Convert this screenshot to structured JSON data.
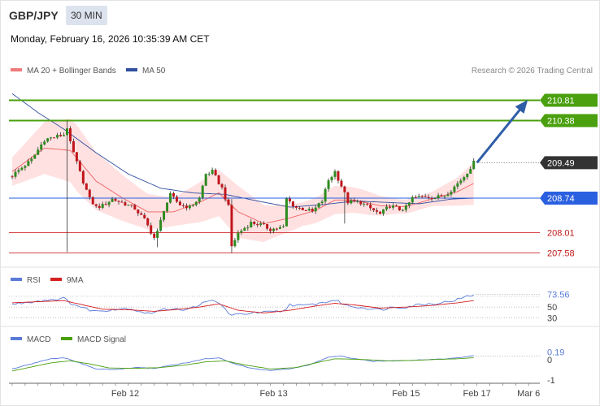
{
  "header": {
    "symbol": "GBP/JPY",
    "timeframe": "30 MIN",
    "datetime": "Monday, February 16, 2026 10:35:39 AM CET"
  },
  "colors": {
    "candle_up": "#2e8b1f",
    "candle_down": "#c0161c",
    "ma20": "#f06060",
    "bands_fill": "#ffdcdc",
    "ma50": "#2f4f9f",
    "resistance": "#4aa00e",
    "support": "#2a5fe0",
    "target_line": "#d84545",
    "arrow": "#2f5ea8",
    "rsi": "#5a7bd8",
    "rsi_ma": "#d62020",
    "macd": "#5a7bd8",
    "macd_signal": "#4aa00e"
  },
  "chart_data": [
    {
      "type": "candlestick",
      "panel": "price",
      "legend": [
        {
          "label": "MA 20 + Bollinger Bands",
          "color": "#f07a7a"
        },
        {
          "label": "MA 50",
          "color": "#2f4f9f"
        }
      ],
      "credit": "Research © 2026 Trading Central",
      "ylim": [
        207.4,
        211.3
      ],
      "x": {
        "bars": 144,
        "bar_labels": [
          {
            "bar": 35,
            "label": "Feb 12"
          },
          {
            "bar": 81,
            "label": "Feb 13"
          },
          {
            "bar": 122,
            "label": "Feb 15"
          },
          {
            "bar": 144,
            "label": "Feb 17"
          },
          {
            "bar": 160,
            "label": "Mar 6"
          }
        ]
      },
      "levels": [
        {
          "label": "210.81",
          "value": 210.81,
          "kind": "resistance"
        },
        {
          "label": "210.38",
          "value": 210.38,
          "kind": "resistance"
        },
        {
          "label": "209.49",
          "value": 209.49,
          "kind": "last_price"
        },
        {
          "label": "208.74",
          "value": 208.74,
          "kind": "support"
        },
        {
          "label": "208.01",
          "value": 208.01,
          "kind": "target"
        },
        {
          "label": "207.58",
          "value": 207.58,
          "kind": "target"
        }
      ],
      "anchors": [
        [
          0,
          209.22
        ],
        [
          6,
          209.55
        ],
        [
          10,
          209.98
        ],
        [
          16,
          210.08
        ],
        [
          17,
          210.24
        ],
        [
          18,
          209.9
        ],
        [
          21,
          209.28
        ],
        [
          24,
          208.72
        ],
        [
          26,
          208.55
        ],
        [
          28,
          208.58
        ],
        [
          31,
          208.72
        ],
        [
          35,
          208.62
        ],
        [
          38,
          208.52
        ],
        [
          41,
          208.28
        ],
        [
          44,
          207.9
        ],
        [
          45,
          208.02
        ],
        [
          47,
          208.5
        ],
        [
          49,
          208.8
        ],
        [
          52,
          208.6
        ],
        [
          55,
          208.55
        ],
        [
          58,
          208.74
        ],
        [
          60,
          209.25
        ],
        [
          62,
          209.3
        ],
        [
          65,
          208.95
        ],
        [
          67,
          208.55
        ],
        [
          68,
          207.72
        ],
        [
          70,
          208.0
        ],
        [
          74,
          208.22
        ],
        [
          77,
          208.18
        ],
        [
          80,
          208.08
        ],
        [
          84,
          208.12
        ],
        [
          85,
          208.72
        ],
        [
          88,
          208.54
        ],
        [
          91,
          208.5
        ],
        [
          93,
          208.45
        ],
        [
          96,
          208.68
        ],
        [
          98,
          209.12
        ],
        [
          100,
          209.3
        ],
        [
          102,
          209.0
        ],
        [
          104,
          208.66
        ],
        [
          108,
          208.65
        ],
        [
          111,
          208.52
        ],
        [
          114,
          208.4
        ],
        [
          117,
          208.58
        ],
        [
          120,
          208.5
        ],
        [
          122,
          208.54
        ],
        [
          124,
          208.74
        ],
        [
          128,
          208.78
        ],
        [
          131,
          208.75
        ],
        [
          134,
          208.8
        ],
        [
          137,
          208.98
        ],
        [
          140,
          209.2
        ],
        [
          143,
          209.49
        ]
      ],
      "wick_spikes": [
        [
          17,
          207.6,
          210.38
        ],
        [
          45,
          207.7,
          208.1
        ],
        [
          68,
          207.58,
          208.72
        ],
        [
          103,
          208.2,
          208.7
        ]
      ],
      "ma20_anchors": [
        [
          0,
          209.3
        ],
        [
          10,
          209.8
        ],
        [
          18,
          209.75
        ],
        [
          26,
          209.1
        ],
        [
          34,
          208.75
        ],
        [
          42,
          208.45
        ],
        [
          50,
          208.45
        ],
        [
          58,
          208.65
        ],
        [
          64,
          208.85
        ],
        [
          70,
          208.45
        ],
        [
          78,
          208.2
        ],
        [
          86,
          208.32
        ],
        [
          94,
          208.48
        ],
        [
          100,
          208.7
        ],
        [
          106,
          208.7
        ],
        [
          114,
          208.58
        ],
        [
          122,
          208.56
        ],
        [
          130,
          208.72
        ],
        [
          138,
          208.88
        ],
        [
          143,
          209.05
        ]
      ],
      "ma50_anchors": [
        [
          0,
          210.95
        ],
        [
          8,
          210.55
        ],
        [
          16,
          210.2
        ],
        [
          26,
          209.7
        ],
        [
          36,
          209.25
        ],
        [
          46,
          208.95
        ],
        [
          56,
          208.85
        ],
        [
          66,
          208.82
        ],
        [
          76,
          208.68
        ],
        [
          86,
          208.55
        ],
        [
          96,
          208.6
        ],
        [
          106,
          208.68
        ],
        [
          116,
          208.65
        ],
        [
          126,
          208.62
        ],
        [
          136,
          208.72
        ],
        [
          143,
          208.74
        ]
      ],
      "band_width": [
        [
          0,
          0.3
        ],
        [
          10,
          0.55
        ],
        [
          20,
          0.7
        ],
        [
          30,
          0.55
        ],
        [
          40,
          0.4
        ],
        [
          50,
          0.3
        ],
        [
          60,
          0.45
        ],
        [
          70,
          0.55
        ],
        [
          80,
          0.35
        ],
        [
          90,
          0.25
        ],
        [
          100,
          0.3
        ],
        [
          110,
          0.25
        ],
        [
          120,
          0.15
        ],
        [
          130,
          0.15
        ],
        [
          138,
          0.3
        ],
        [
          143,
          0.45
        ]
      ],
      "arrow": {
        "from": [
          143,
          209.49
        ],
        "to": [
          160,
          210.81
        ]
      }
    },
    {
      "type": "line",
      "panel": "rsi",
      "legend": [
        {
          "label": "RSI",
          "color": "#5a7bd8"
        },
        {
          "label": "9MA",
          "color": "#d62020"
        }
      ],
      "ylim": [
        20,
        85
      ],
      "ticks": [
        {
          "value": 50,
          "label": "50"
        },
        {
          "value": 30,
          "label": "30"
        }
      ],
      "current": {
        "value": 73.56,
        "label": "73.56"
      },
      "series": [
        {
          "name": "RSI",
          "anchors": [
            [
              0,
              55
            ],
            [
              6,
              60
            ],
            [
              12,
              64
            ],
            [
              16,
              66
            ],
            [
              18,
              58
            ],
            [
              22,
              48
            ],
            [
              26,
              42
            ],
            [
              30,
              45
            ],
            [
              36,
              48
            ],
            [
              42,
              38
            ],
            [
              46,
              44
            ],
            [
              50,
              48
            ],
            [
              54,
              44
            ],
            [
              58,
              55
            ],
            [
              62,
              62
            ],
            [
              64,
              58
            ],
            [
              68,
              34
            ],
            [
              72,
              38
            ],
            [
              78,
              40
            ],
            [
              84,
              42
            ],
            [
              86,
              55
            ],
            [
              90,
              52
            ],
            [
              96,
              58
            ],
            [
              100,
              63
            ],
            [
              104,
              52
            ],
            [
              110,
              48
            ],
            [
              114,
              45
            ],
            [
              118,
              50
            ],
            [
              122,
              50
            ],
            [
              126,
              55
            ],
            [
              130,
              56
            ],
            [
              134,
              59
            ],
            [
              138,
              64
            ],
            [
              143,
              73.56
            ]
          ]
        },
        {
          "name": "9MA",
          "anchors": [
            [
              0,
              58
            ],
            [
              8,
              60
            ],
            [
              16,
              62
            ],
            [
              22,
              54
            ],
            [
              28,
              46
            ],
            [
              36,
              45
            ],
            [
              44,
              42
            ],
            [
              50,
              45
            ],
            [
              58,
              50
            ],
            [
              64,
              56
            ],
            [
              70,
              44
            ],
            [
              78,
              39
            ],
            [
              86,
              44
            ],
            [
              94,
              52
            ],
            [
              100,
              57
            ],
            [
              106,
              54
            ],
            [
              114,
              48
            ],
            [
              122,
              50
            ],
            [
              130,
              53
            ],
            [
              138,
              58
            ],
            [
              143,
              62
            ]
          ]
        }
      ]
    },
    {
      "type": "line",
      "panel": "macd",
      "legend": [
        {
          "label": "MACD",
          "color": "#5a7bd8"
        },
        {
          "label": "MACD Signal",
          "color": "#4aa00e"
        }
      ],
      "ylim": [
        -1.15,
        0.6
      ],
      "ticks": [
        {
          "value": 0,
          "label": "0"
        },
        {
          "value": -1,
          "label": "-1"
        }
      ],
      "current": {
        "value": 0.19,
        "label": "0.19"
      },
      "series": [
        {
          "name": "MACD",
          "anchors": [
            [
              0,
              -0.45
            ],
            [
              6,
              -0.2
            ],
            [
              12,
              0.05
            ],
            [
              16,
              0.1
            ],
            [
              20,
              -0.1
            ],
            [
              26,
              -0.45
            ],
            [
              32,
              -0.48
            ],
            [
              38,
              -0.38
            ],
            [
              44,
              -0.42
            ],
            [
              48,
              -0.3
            ],
            [
              54,
              -0.15
            ],
            [
              60,
              0.05
            ],
            [
              64,
              0.1
            ],
            [
              68,
              -0.15
            ],
            [
              74,
              -0.42
            ],
            [
              80,
              -0.52
            ],
            [
              86,
              -0.45
            ],
            [
              92,
              -0.25
            ],
            [
              98,
              0.12
            ],
            [
              102,
              0.18
            ],
            [
              106,
              0.05
            ],
            [
              112,
              -0.08
            ],
            [
              118,
              -0.05
            ],
            [
              124,
              -0.02
            ],
            [
              130,
              0.02
            ],
            [
              136,
              0.06
            ],
            [
              143,
              0.19
            ]
          ]
        },
        {
          "name": "MACD Signal",
          "anchors": [
            [
              0,
              -0.55
            ],
            [
              6,
              -0.35
            ],
            [
              12,
              -0.15
            ],
            [
              18,
              -0.05
            ],
            [
              24,
              -0.2
            ],
            [
              30,
              -0.4
            ],
            [
              38,
              -0.42
            ],
            [
              46,
              -0.38
            ],
            [
              54,
              -0.25
            ],
            [
              60,
              -0.1
            ],
            [
              66,
              -0.05
            ],
            [
              72,
              -0.25
            ],
            [
              80,
              -0.45
            ],
            [
              88,
              -0.38
            ],
            [
              94,
              -0.15
            ],
            [
              100,
              0.05
            ],
            [
              108,
              0.02
            ],
            [
              116,
              -0.05
            ],
            [
              124,
              -0.03
            ],
            [
              132,
              0.02
            ],
            [
              138,
              0.05
            ],
            [
              143,
              0.1
            ]
          ]
        }
      ]
    }
  ]
}
